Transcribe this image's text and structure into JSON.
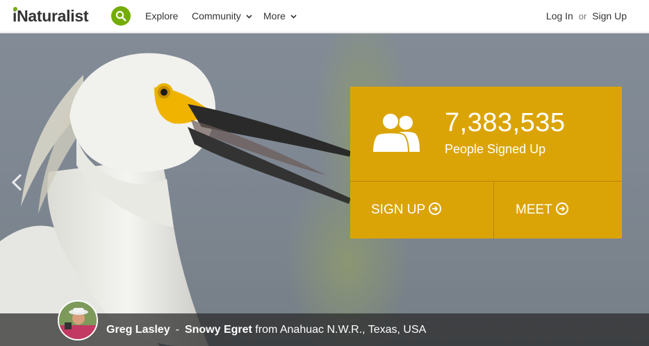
{
  "header": {
    "logo": "iNaturalist",
    "nav": [
      {
        "label": "Explore"
      },
      {
        "label": "Community"
      },
      {
        "label": "More"
      }
    ],
    "login_label": "Log In",
    "or_label": "or",
    "signup_label": "Sign Up"
  },
  "stats": {
    "count": "7,383,535",
    "label": "People Signed Up",
    "sign_up_cta": "SIGN UP",
    "meet_cta": "MEET"
  },
  "credit": {
    "photographer": "Greg Lasley",
    "separator": "-",
    "species": "Snowy Egret",
    "location": "from Anahuac N.W.R., Texas, USA"
  },
  "colors": {
    "brand_green": "#74ac00",
    "stats_gold": "#dba406",
    "text_dark": "#333333"
  },
  "icons": {
    "search": "search-icon",
    "people": "people-icon",
    "arrow": "arrow-circle-right-icon",
    "prev": "chevron-left-icon"
  }
}
